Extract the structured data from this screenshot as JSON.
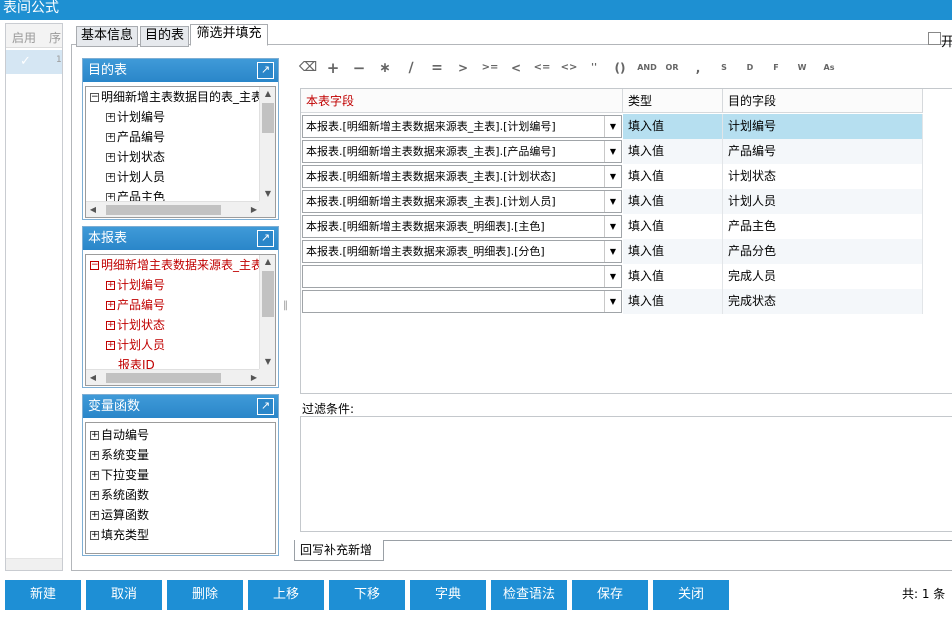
{
  "window": {
    "title": "表间公式"
  },
  "left_list": {
    "headers": [
      "启用",
      "序"
    ],
    "rows": [
      {
        "enabled": true,
        "index": "1"
      }
    ]
  },
  "tabs": [
    {
      "label": "基本信息",
      "active": false
    },
    {
      "label": "目的表",
      "active": false
    },
    {
      "label": "筛选并填充",
      "active": true
    }
  ],
  "top_checkbox": {
    "label": "开"
  },
  "panels": {
    "target_table": {
      "title": "目的表",
      "root": "明细新增主表数据目的表_主表",
      "items": [
        "计划编号",
        "产品编号",
        "计划状态",
        "计划人员",
        "产品主色"
      ]
    },
    "this_report": {
      "title": "本报表",
      "root": "明细新增主表数据来源表_主表",
      "items": [
        "计划编号",
        "产品编号",
        "计划状态",
        "计划人员",
        "报表ID"
      ]
    },
    "var_functions": {
      "title": "变量函数",
      "items": [
        "自动编号",
        "系统变量",
        "下拉变量",
        "系统函数",
        "运算函数",
        "填充类型"
      ]
    }
  },
  "toolbar": [
    {
      "icon": "clear-icon",
      "symbol": "⌫"
    },
    {
      "icon": "plus-icon",
      "symbol": "+"
    },
    {
      "icon": "minus-icon",
      "symbol": "−"
    },
    {
      "icon": "multiply-icon",
      "symbol": "∗"
    },
    {
      "icon": "divide-icon",
      "symbol": "∕"
    },
    {
      "icon": "equals-icon",
      "symbol": "="
    },
    {
      "icon": "greater-icon",
      "symbol": ">"
    },
    {
      "icon": "greater-equal-icon",
      "symbol": ">="
    },
    {
      "icon": "less-icon",
      "symbol": "<"
    },
    {
      "icon": "less-equal-icon",
      "symbol": "<="
    },
    {
      "icon": "not-equal-icon",
      "symbol": "<>"
    },
    {
      "icon": "quotes-icon",
      "symbol": "''"
    },
    {
      "icon": "parentheses-icon",
      "symbol": "()"
    },
    {
      "icon": "and-icon",
      "symbol": "AND"
    },
    {
      "icon": "or-icon",
      "symbol": "OR"
    },
    {
      "icon": "comma-icon",
      "symbol": ","
    },
    {
      "icon": "s-icon",
      "symbol": "S"
    },
    {
      "icon": "d-icon",
      "symbol": "D"
    },
    {
      "icon": "f-icon",
      "symbol": "F"
    },
    {
      "icon": "w-icon",
      "symbol": "W"
    },
    {
      "icon": "as-icon",
      "symbol": "As"
    }
  ],
  "grid": {
    "columns": [
      "本表字段",
      "类型",
      "目的字段"
    ],
    "rows": [
      {
        "source": "本报表.[明细新增主表数据来源表_主表].[计划编号]",
        "type": "填入值",
        "target": "计划编号"
      },
      {
        "source": "本报表.[明细新增主表数据来源表_主表].[产品编号]",
        "type": "填入值",
        "target": "产品编号"
      },
      {
        "source": "本报表.[明细新增主表数据来源表_主表].[计划状态]",
        "type": "填入值",
        "target": "计划状态"
      },
      {
        "source": "本报表.[明细新增主表数据来源表_主表].[计划人员]",
        "type": "填入值",
        "target": "计划人员"
      },
      {
        "source": "本报表.[明细新增主表数据来源表_明细表].[主色]",
        "type": "填入值",
        "target": "产品主色"
      },
      {
        "source": "本报表.[明细新增主表数据来源表_明细表].[分色]",
        "type": "填入值",
        "target": "产品分色"
      },
      {
        "source": "",
        "type": "填入值",
        "target": "完成人员"
      },
      {
        "source": "",
        "type": "填入值",
        "target": "完成状态"
      }
    ],
    "selected_row": 0
  },
  "filter": {
    "label": "过滤条件:",
    "value": ""
  },
  "bottom_tab": {
    "label": "回写补充新增"
  },
  "buttons": [
    "新建",
    "取消",
    "删除",
    "上移",
    "下移",
    "字典",
    "检查语法",
    "保存",
    "关闭"
  ],
  "footer": {
    "text": "共: 1 条"
  },
  "colors": {
    "accent": "#1e8fd5",
    "selected_row": "#b6dff0",
    "header_red": "#c00000"
  }
}
